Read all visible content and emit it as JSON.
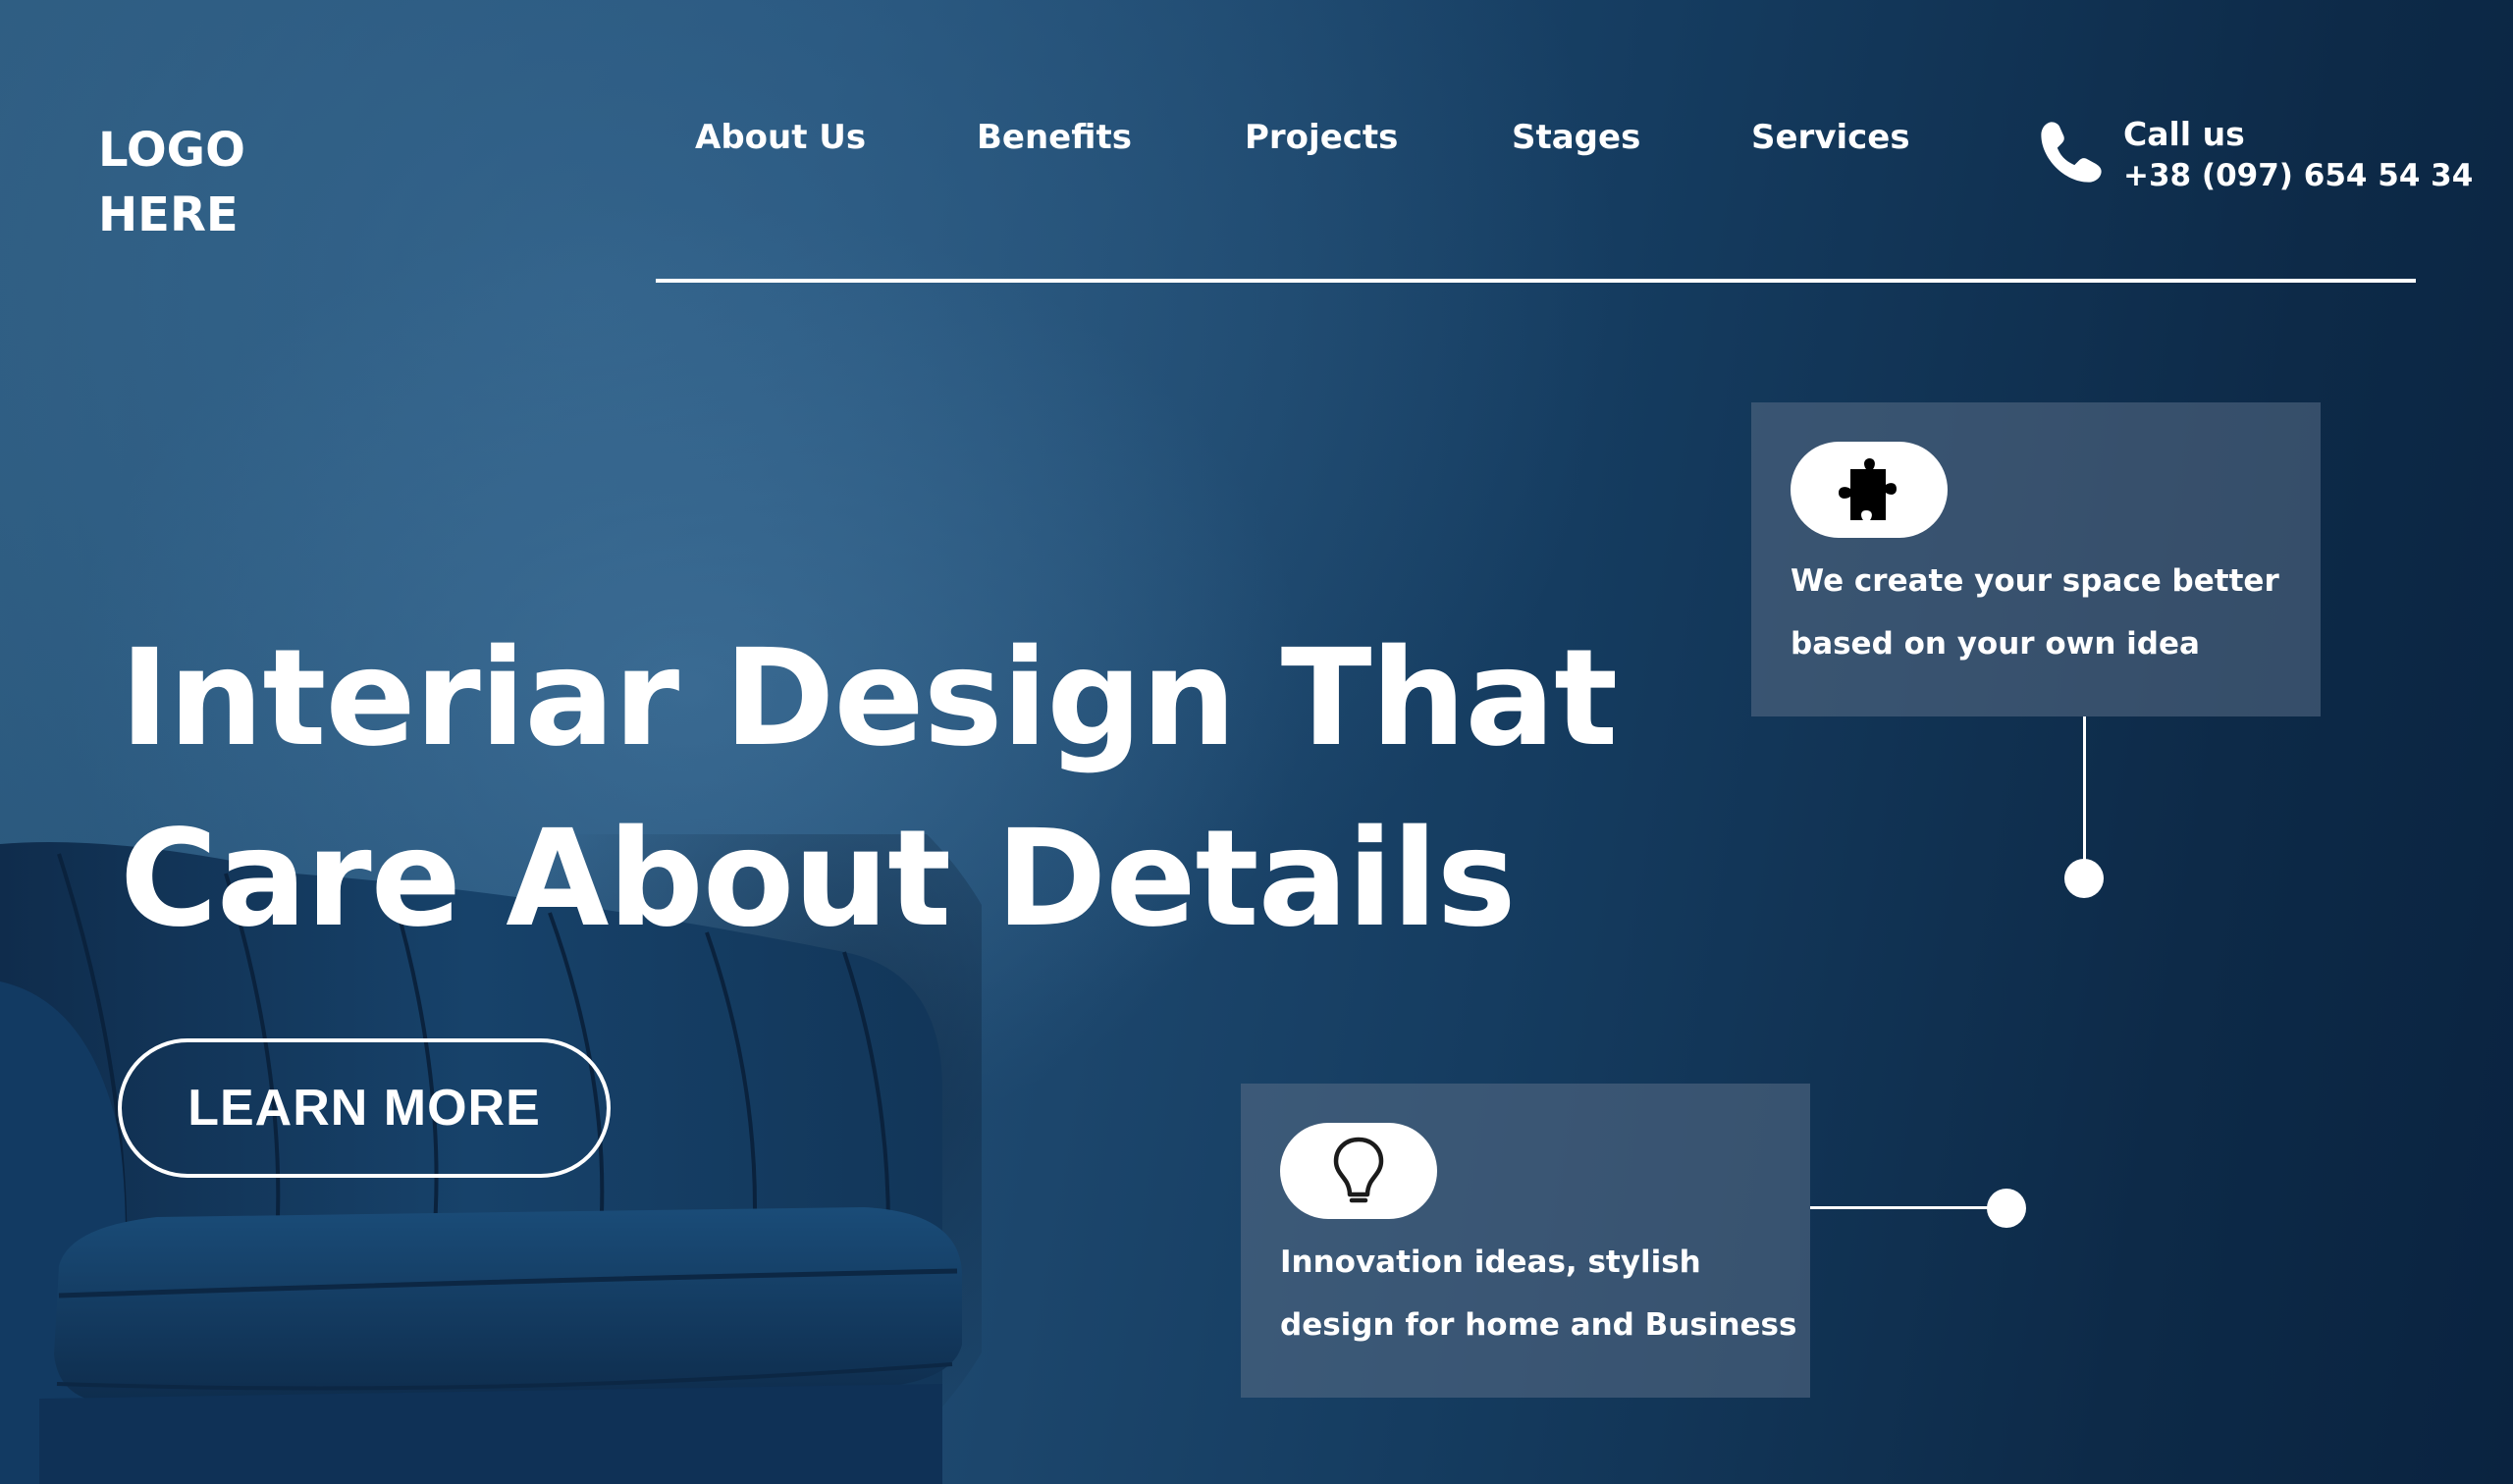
{
  "logo": {
    "line1": "LOGO",
    "line2": "HERE"
  },
  "nav": {
    "items": [
      {
        "label": "About Us"
      },
      {
        "label": "Benefits"
      },
      {
        "label": "Projects"
      },
      {
        "label": "Stages"
      },
      {
        "label": "Services"
      }
    ]
  },
  "contact": {
    "icon": "phone-icon",
    "label": "Call us",
    "phone": "+38 (097) 654 54 34"
  },
  "hero": {
    "title_line1": "Interiar Design That",
    "title_line2": "Care About Details",
    "cta_label": "LEARN MORE"
  },
  "features": [
    {
      "icon": "puzzle-piece-icon",
      "line1": "We create your space better",
      "line2": "based on your own idea"
    },
    {
      "icon": "lightbulb-icon",
      "line1": "Innovation ideas, stylish",
      "line2": "design for home and Business"
    }
  ],
  "colors": {
    "background_light": "#2c5a7e",
    "background_dark": "#0a2340",
    "card_overlay": "#5a6e87",
    "text": "#ffffff"
  }
}
